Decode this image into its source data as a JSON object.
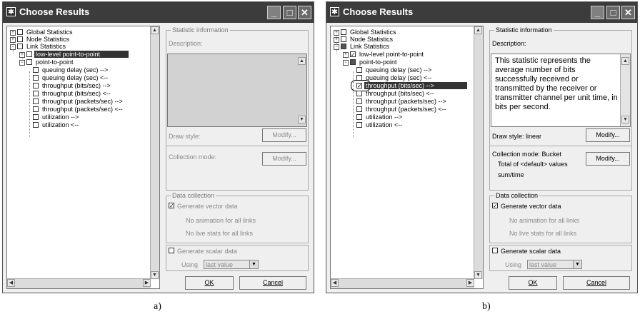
{
  "windows": [
    {
      "title": "Choose Results",
      "tree": [
        {
          "label": "Global Statistics",
          "state": "plus",
          "checked": false
        },
        {
          "label": "Node Statistics",
          "state": "plus",
          "checked": false
        },
        {
          "label": "Link Statistics",
          "state": "minus",
          "checked": false
        },
        {
          "label": "low-level point-to-point",
          "state": "plus",
          "checked": false,
          "selected": true
        },
        {
          "label": "point-to-point",
          "state": "minus",
          "checked": false
        },
        {
          "label": "queuing delay (sec) -->",
          "checked": false
        },
        {
          "label": "queuing delay (sec) <--",
          "checked": false
        },
        {
          "label": "throughput (bits/sec) -->",
          "checked": false
        },
        {
          "label": "throughput (bits/sec) <--",
          "checked": false
        },
        {
          "label": "throughput (packets/sec) -->",
          "checked": false
        },
        {
          "label": "throughput (packets/sec) <--",
          "checked": false
        },
        {
          "label": "utilization -->",
          "checked": false
        },
        {
          "label": "utilization <--",
          "checked": false
        }
      ],
      "stat_info_label": "Statistic information",
      "description_label": "Description:",
      "description_text": "",
      "draw_style_label": "Draw style:",
      "modify_label": "Modify...",
      "collection_mode_label": "Collection mode:",
      "collection_line2": "",
      "collection_line3": "",
      "data_collection_label": "Data collection",
      "generate_vector_label": "Generate vector data",
      "vector_checked": true,
      "no_animation_label": "No animation for all links",
      "no_live_label": "No live stats for all links",
      "generate_scalar_label": "Generate scalar data",
      "scalar_checked": false,
      "using_label": "Using",
      "using_value": "last value",
      "ok_label": "OK",
      "cancel_label": "Cancel",
      "caption": "a)"
    },
    {
      "title": "Choose Results",
      "tree": [
        {
          "label": "Global Statistics",
          "state": "plus",
          "checked": false
        },
        {
          "label": "Node Statistics",
          "state": "plus",
          "checked": false
        },
        {
          "label": "Link Statistics",
          "state": "minus",
          "checked": "partial"
        },
        {
          "label": "low-level point-to-point",
          "state": "plus",
          "checked": true
        },
        {
          "label": "point-to-point",
          "state": "minus",
          "checked": "partial"
        },
        {
          "label": "queuing delay (sec) -->",
          "checked": false
        },
        {
          "label": "queuing delay (sec) <--",
          "checked": false
        },
        {
          "label": "throughput (bits/sec) -->",
          "checked": true,
          "selected": true
        },
        {
          "label": "throughput (bits/sec) <--",
          "checked": false
        },
        {
          "label": "throughput (packets/sec) -->",
          "checked": false
        },
        {
          "label": "throughput (packets/sec) <--",
          "checked": false
        },
        {
          "label": "utilization -->",
          "checked": false
        },
        {
          "label": "utilization <--",
          "checked": false
        }
      ],
      "stat_info_label": "Statistic information",
      "description_label": "Description:",
      "description_text": "This statistic represents the average number of bits successfully received or transmitted by the receiver or transmitter channel per unit time, in bits per second.",
      "draw_style_label": "Draw style: linear",
      "modify_label": "Modify...",
      "collection_mode_label": "Collection mode: Bucket",
      "collection_line2": "Total of <default> values",
      "collection_line3": "sum/time",
      "data_collection_label": "Data collection",
      "generate_vector_label": "Generate vector data",
      "vector_checked": true,
      "no_animation_label": "No animation for all links",
      "no_live_label": "No live stats for all links",
      "generate_scalar_label": "Generate scalar data",
      "scalar_checked": false,
      "using_label": "Using",
      "using_value": "last value",
      "ok_label": "OK",
      "cancel_label": "Cancel",
      "caption": "b)"
    }
  ]
}
